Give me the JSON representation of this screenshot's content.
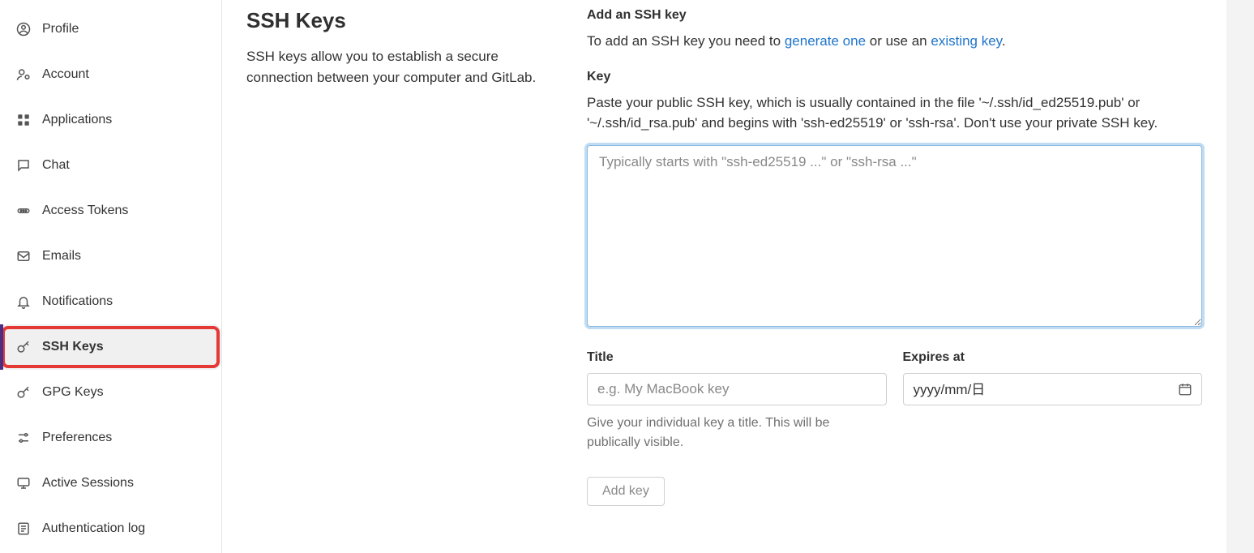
{
  "sidebar": {
    "items": [
      {
        "label": "Profile",
        "icon": "user-circle-icon"
      },
      {
        "label": "Account",
        "icon": "user-gear-icon"
      },
      {
        "label": "Applications",
        "icon": "apps-grid-icon"
      },
      {
        "label": "Chat",
        "icon": "chat-icon"
      },
      {
        "label": "Access Tokens",
        "icon": "token-icon"
      },
      {
        "label": "Emails",
        "icon": "mail-icon"
      },
      {
        "label": "Notifications",
        "icon": "bell-icon"
      },
      {
        "label": "SSH Keys",
        "icon": "key-icon",
        "active": true,
        "highlighted": true
      },
      {
        "label": "GPG Keys",
        "icon": "key-icon"
      },
      {
        "label": "Preferences",
        "icon": "sliders-icon"
      },
      {
        "label": "Active Sessions",
        "icon": "monitor-icon"
      },
      {
        "label": "Authentication log",
        "icon": "list-icon"
      }
    ]
  },
  "page": {
    "title": "SSH Keys",
    "description": "SSH keys allow you to establish a secure connection between your computer and GitLab."
  },
  "form": {
    "add_heading": "Add an SSH key",
    "add_intro_pre": "To add an SSH key you need to ",
    "add_link_generate": "generate one",
    "add_intro_mid": " or use an ",
    "add_link_existing": "existing key",
    "add_intro_post": ".",
    "key_label": "Key",
    "key_help": "Paste your public SSH key, which is usually contained in the file '~/.ssh/id_ed25519.pub' or '~/.ssh/id_rsa.pub' and begins with 'ssh-ed25519' or 'ssh-rsa'. Don't use your private SSH key.",
    "key_placeholder": "Typically starts with \"ssh-ed25519 ...\" or \"ssh-rsa ...\"",
    "key_value": "",
    "title_label": "Title",
    "title_placeholder": "e.g. My MacBook key",
    "title_value": "",
    "title_help": "Give your individual key a title. This will be publically visible.",
    "expires_label": "Expires at",
    "expires_value": "yyyy/mm/日",
    "add_button": "Add key"
  }
}
